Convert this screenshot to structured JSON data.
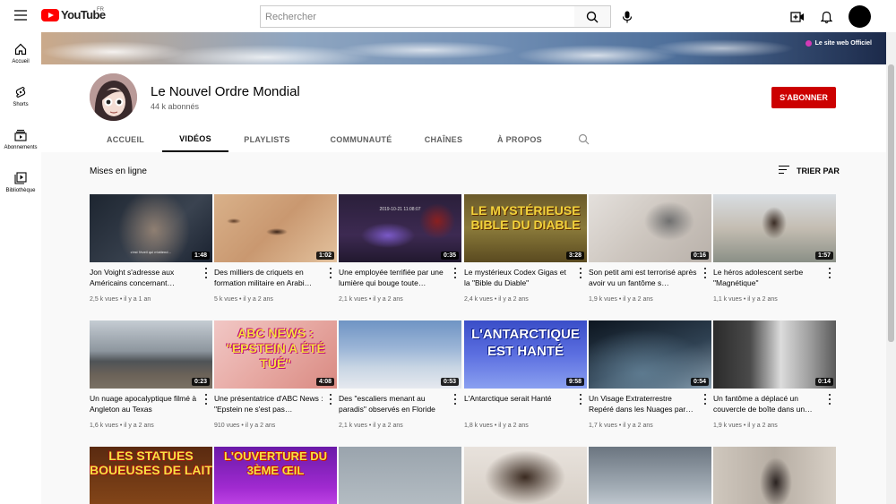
{
  "topbar": {
    "logo_text": "YouTube",
    "logo_country": "FR",
    "search_placeholder": "Rechercher"
  },
  "sidebar": {
    "items": [
      {
        "label": "Accueil",
        "icon": "home-icon"
      },
      {
        "label": "Shorts",
        "icon": "shorts-icon"
      },
      {
        "label": "Abonnements",
        "icon": "subscriptions-icon"
      },
      {
        "label": "Bibliothèque",
        "icon": "library-icon"
      }
    ]
  },
  "banner": {
    "link_label": "Le site web Officiel"
  },
  "channel": {
    "name": "Le Nouvel Ordre Mondial",
    "subscribers": "44 k abonnés",
    "subscribe_label": "S'ABONNER"
  },
  "tabs": [
    {
      "label": "ACCUEIL",
      "active": false
    },
    {
      "label": "VIDÉOS",
      "active": true
    },
    {
      "label": "PLAYLISTS",
      "active": false
    },
    {
      "label": "COMMUNAUTÉ",
      "active": false
    },
    {
      "label": "CHAÎNES",
      "active": false
    },
    {
      "label": "À PROPOS",
      "active": false
    }
  ],
  "section": {
    "title": "Mises en ligne",
    "sort_label": "TRIER PAR"
  },
  "videos": [
    {
      "title": "Jon Voight s'adresse aux Américains concernant…",
      "duration": "1:48",
      "views": "2,5 k vues",
      "age": "il y a 1 an",
      "thumb_caption": "c'est l'éveil qui m'attend…"
    },
    {
      "title": "Des milliers de criquets en formation militaire en Arabi…",
      "duration": "1:02",
      "views": "5 k vues",
      "age": "il y a 2 ans"
    },
    {
      "title": "Une employée terrifiée par une lumière qui bouge toute…",
      "duration": "0:35",
      "views": "2,1 k vues",
      "age": "il y a 2 ans",
      "thumb_caption": "2019-10-21 11:08:07"
    },
    {
      "title": "Le mystérieux Codex Gigas et la \"Bible du Diable\"",
      "duration": "3:28",
      "views": "2,4 k vues",
      "age": "il y a 2 ans",
      "thumb_text": "LE MYSTÉRIEUSE BIBLE DU DIABLE"
    },
    {
      "title": "Son petit ami est terrorisé après avoir vu un fantôme s…",
      "duration": "0:16",
      "views": "1,9 k vues",
      "age": "il y a 2 ans"
    },
    {
      "title": "Le héros adolescent serbe \"Magnétique\"",
      "duration": "1:57",
      "views": "1,1 k vues",
      "age": "il y a 2 ans"
    },
    {
      "title": "Un nuage apocalyptique filmé à Angleton au Texas",
      "duration": "0:23",
      "views": "1,6 k vues",
      "age": "il y a 2 ans"
    },
    {
      "title": "Une présentatrice d'ABC News : \"Epstein ne s'est pas…",
      "duration": "4:08",
      "views": "910 vues",
      "age": "il y a 2 ans",
      "thumb_text": "ABC NEWS : \"EPSTEIN A ÉTÉ TUÉ\""
    },
    {
      "title": "Des \"escaliers menant au paradis\" observés en Floride",
      "duration": "0:53",
      "views": "2,1 k vues",
      "age": "il y a 2 ans"
    },
    {
      "title": "L'Antarctique serait Hanté",
      "duration": "9:58",
      "views": "1,8 k vues",
      "age": "il y a 2 ans",
      "thumb_text": "L'ANTARCTIQUE EST HANTÉ"
    },
    {
      "title": "Un Visage Extraterrestre Repéré dans les Nuages par…",
      "duration": "0:54",
      "views": "1,7 k vues",
      "age": "il y a 2 ans"
    },
    {
      "title": "Un fantôme a déplacé un couvercle de boîte dans un…",
      "duration": "0:14",
      "views": "1,9 k vues",
      "age": "il y a 2 ans"
    },
    {
      "title": "",
      "duration": "",
      "views": "",
      "age": "",
      "thumb_text": "LES STATUES BOUEUSES DE LAIT"
    },
    {
      "title": "",
      "duration": "",
      "views": "",
      "age": "",
      "thumb_text": "L'OUVERTURE DU 3ÈME ŒIL"
    },
    {
      "title": "",
      "duration": "",
      "views": "",
      "age": ""
    },
    {
      "title": "",
      "duration": "",
      "views": "",
      "age": ""
    },
    {
      "title": "",
      "duration": "",
      "views": "",
      "age": ""
    },
    {
      "title": "",
      "duration": "",
      "views": "",
      "age": ""
    }
  ]
}
